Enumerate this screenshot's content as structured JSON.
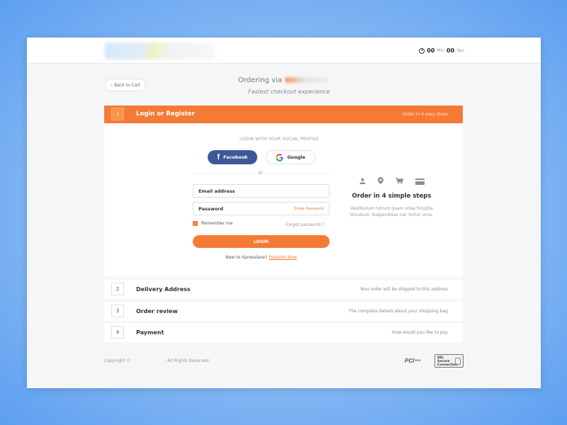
{
  "timer": {
    "minutes": "00",
    "min_label": "Min",
    "seconds": "00",
    "sec_label": "Sec"
  },
  "header": {
    "back_label": "Back to Cart",
    "ordering_via": "Ordering via",
    "tagline": "Fastest checkout experience"
  },
  "step1": {
    "number": "1",
    "title": "Login or Register",
    "hint": "Order in 4 easy steps"
  },
  "login": {
    "social_title": "LOGIN WITH YOUR SOCIAL PROFILE",
    "facebook_label": "Facebook",
    "google_label": "Google",
    "or_label": "Or",
    "email_placeholder": "Email address",
    "password_placeholder": "Password",
    "show_password": "Show Password",
    "remember_me": "Remember me",
    "forgot_password": "Forgot password ?",
    "login_button": "LOGIN",
    "new_user_text": "New to Xpresslane?",
    "register_now": "Register Now"
  },
  "info": {
    "title": "Order in 4 simple steps",
    "description": "Vestibulum rutrum quam vitae fringilla tincidunt. Suspendisse nec tortor urna.",
    "icons": [
      "user-icon",
      "location-pin-icon",
      "cart-icon",
      "card-icon"
    ]
  },
  "steps": [
    {
      "number": "2",
      "title": "Delivery Address",
      "desc": "Your order will be shipped to this address"
    },
    {
      "number": "3",
      "title": "Order review",
      "desc": "The complete details about your shopping bag"
    },
    {
      "number": "4",
      "title": "Payment",
      "desc": "How would you like to pay"
    }
  ],
  "footer": {
    "copyright_prefix": "Copyright ©",
    "copyright_suffix": "- All Rights Reserved",
    "pci_label": "PCI",
    "pci_small": "DSS",
    "ssl_line1": "SSL",
    "ssl_line2": "Secure",
    "ssl_line3": "Connection"
  },
  "colors": {
    "accent": "#f57a35",
    "facebook": "#3b5998",
    "background": "#f4f6f8"
  }
}
